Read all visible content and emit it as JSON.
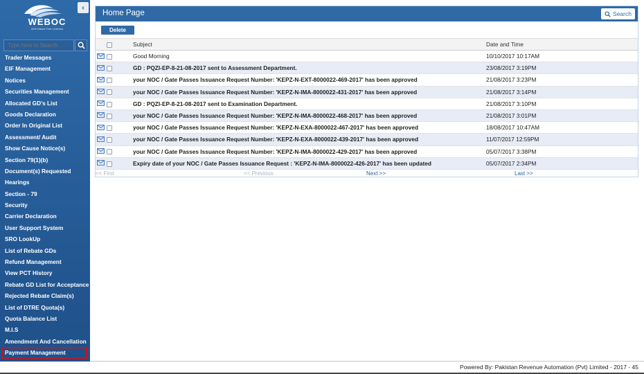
{
  "brand": {
    "logo_text": "WEBOC",
    "logo_subtitle": "Web Based One Customs"
  },
  "sidebar": {
    "search_placeholder": "Type here to Search",
    "items": [
      {
        "label": "Trader Messages"
      },
      {
        "label": "EIF Management"
      },
      {
        "label": "Notices"
      },
      {
        "label": "Securities Management"
      },
      {
        "label": "Allocated GD's List"
      },
      {
        "label": "Goods Declaration"
      },
      {
        "label": "Order In Original List"
      },
      {
        "label": "Assessment/ Audit"
      },
      {
        "label": "Show Cause Notice(s)"
      },
      {
        "label": "Section 79(1)(b)"
      },
      {
        "label": "Document(s) Requested"
      },
      {
        "label": "Hearings"
      },
      {
        "label": "Section - 79"
      },
      {
        "label": "Security"
      },
      {
        "label": "Carrier Declaration"
      },
      {
        "label": "User Support System"
      },
      {
        "label": "SRO LookUp"
      },
      {
        "label": "List of Rebate GDs"
      },
      {
        "label": "Refund Management"
      },
      {
        "label": "View PCT History"
      },
      {
        "label": "Rebate GD List for Acceptance"
      },
      {
        "label": "Rejected Rebate Claim(s)"
      },
      {
        "label": "List of DTRE Quota(s)"
      },
      {
        "label": "Quota Balance List"
      },
      {
        "label": "M.I.S"
      },
      {
        "label": "Amendment And Cancellation"
      },
      {
        "label": "Payment Management",
        "highlighted": true
      }
    ]
  },
  "main": {
    "title": "Home Page",
    "search_label": "Search",
    "delete_label": "Delete",
    "columns": {
      "subject": "Subject",
      "date": "Date and Time"
    },
    "messages": [
      {
        "subject": "Good Morning",
        "date": "10/10/2017 10:17AM",
        "bold": false
      },
      {
        "subject": "GD : PQZI-EP-8-21-08-2017 sent to Assessment Department.",
        "date": "23/08/2017 3:19PM",
        "bold": true
      },
      {
        "subject": "your NOC / Gate Passes Issuance Request Number: 'KEPZ-N-EXT-8000022-469-2017' has been approved",
        "date": "21/08/2017 3:23PM",
        "bold": true
      },
      {
        "subject": "your NOC / Gate Passes Issuance Request Number: 'KEPZ-N-IMA-8000022-431-2017' has been approved",
        "date": "21/08/2017 3:14PM",
        "bold": true
      },
      {
        "subject": "GD : PQZI-EP-8-21-08-2017 sent to Examination Department.",
        "date": "21/08/2017 3:10PM",
        "bold": true
      },
      {
        "subject": "your NOC / Gate Passes Issuance Request Number: 'KEPZ-N-IMA-8000022-468-2017' has been approved",
        "date": "21/08/2017 3:01PM",
        "bold": true
      },
      {
        "subject": "your NOC / Gate Passes Issuance Request Number: 'KEPZ-N-EXA-8000022-467-2017' has been approved",
        "date": "18/08/2017 10:47AM",
        "bold": true
      },
      {
        "subject": "your NOC / Gate Passes Issuance Request Number: 'KEPZ-N-EXA-8000022-439-2017' has been approved",
        "date": "11/07/2017 12:59PM",
        "bold": true
      },
      {
        "subject": "your NOC / Gate Passes Issuance Request Number: 'KEPZ-N-IMA-8000022-429-2017' has been approved",
        "date": "05/07/2017 3:38PM",
        "bold": true
      },
      {
        "subject": "Expiry date of your NOC / Gate Passes Issuance Request : 'KEPZ-N-IMA-8000022-426-2017' has been updated",
        "date": "05/07/2017 2:34PM",
        "bold": true
      }
    ],
    "pager": {
      "first": "<< First",
      "previous": "<< Previous",
      "next": "Next >>",
      "last": "Last >>"
    }
  },
  "footer": {
    "text": "Powered By: Pakistan Revenue Automation (Pvt) Limited - 2017 - 45"
  },
  "colors": {
    "sidebar": "#2e6aa8",
    "header": "#2f6aa6",
    "row_alt": "#e7ecf6",
    "highlight_border": "#d0121b"
  }
}
